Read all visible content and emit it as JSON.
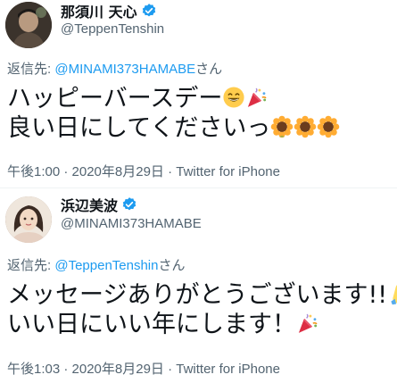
{
  "tweets": [
    {
      "display_name": "那須川 天心",
      "handle": "@TeppenTenshin",
      "reply_prefix": "返信先: ",
      "reply_to": "@MINAMI373HAMABE",
      "reply_suffix": "さん",
      "lines": [
        "ハッピーバースデー",
        "良い日にしてくださいっ"
      ],
      "emoji": [
        "grinning-face-emoji",
        "party-popper-emoji",
        "sunflower-emoji",
        "sunflower-emoji",
        "sunflower-emoji"
      ],
      "timestamp": "午後1:00 · 2020年8月29日 · Twitter for iPhone"
    },
    {
      "display_name": "浜辺美波",
      "handle": "@MINAMI373HAMABE",
      "reply_prefix": "返信先: ",
      "reply_to": "@TeppenTenshin",
      "reply_suffix": "さん",
      "lines": [
        "メッセージありがとうございます!!",
        "いい日にいい年にします！"
      ],
      "emoji": [
        "folded-hands-emoji",
        "party-popper-emoji"
      ],
      "timestamp": "午後1:03 · 2020年8月29日 · Twitter for iPhone"
    }
  ],
  "colors": {
    "verified": "#1d9bf0",
    "link": "#1d9bf0",
    "secondary_text": "#536471",
    "primary_text": "#0f1419"
  }
}
